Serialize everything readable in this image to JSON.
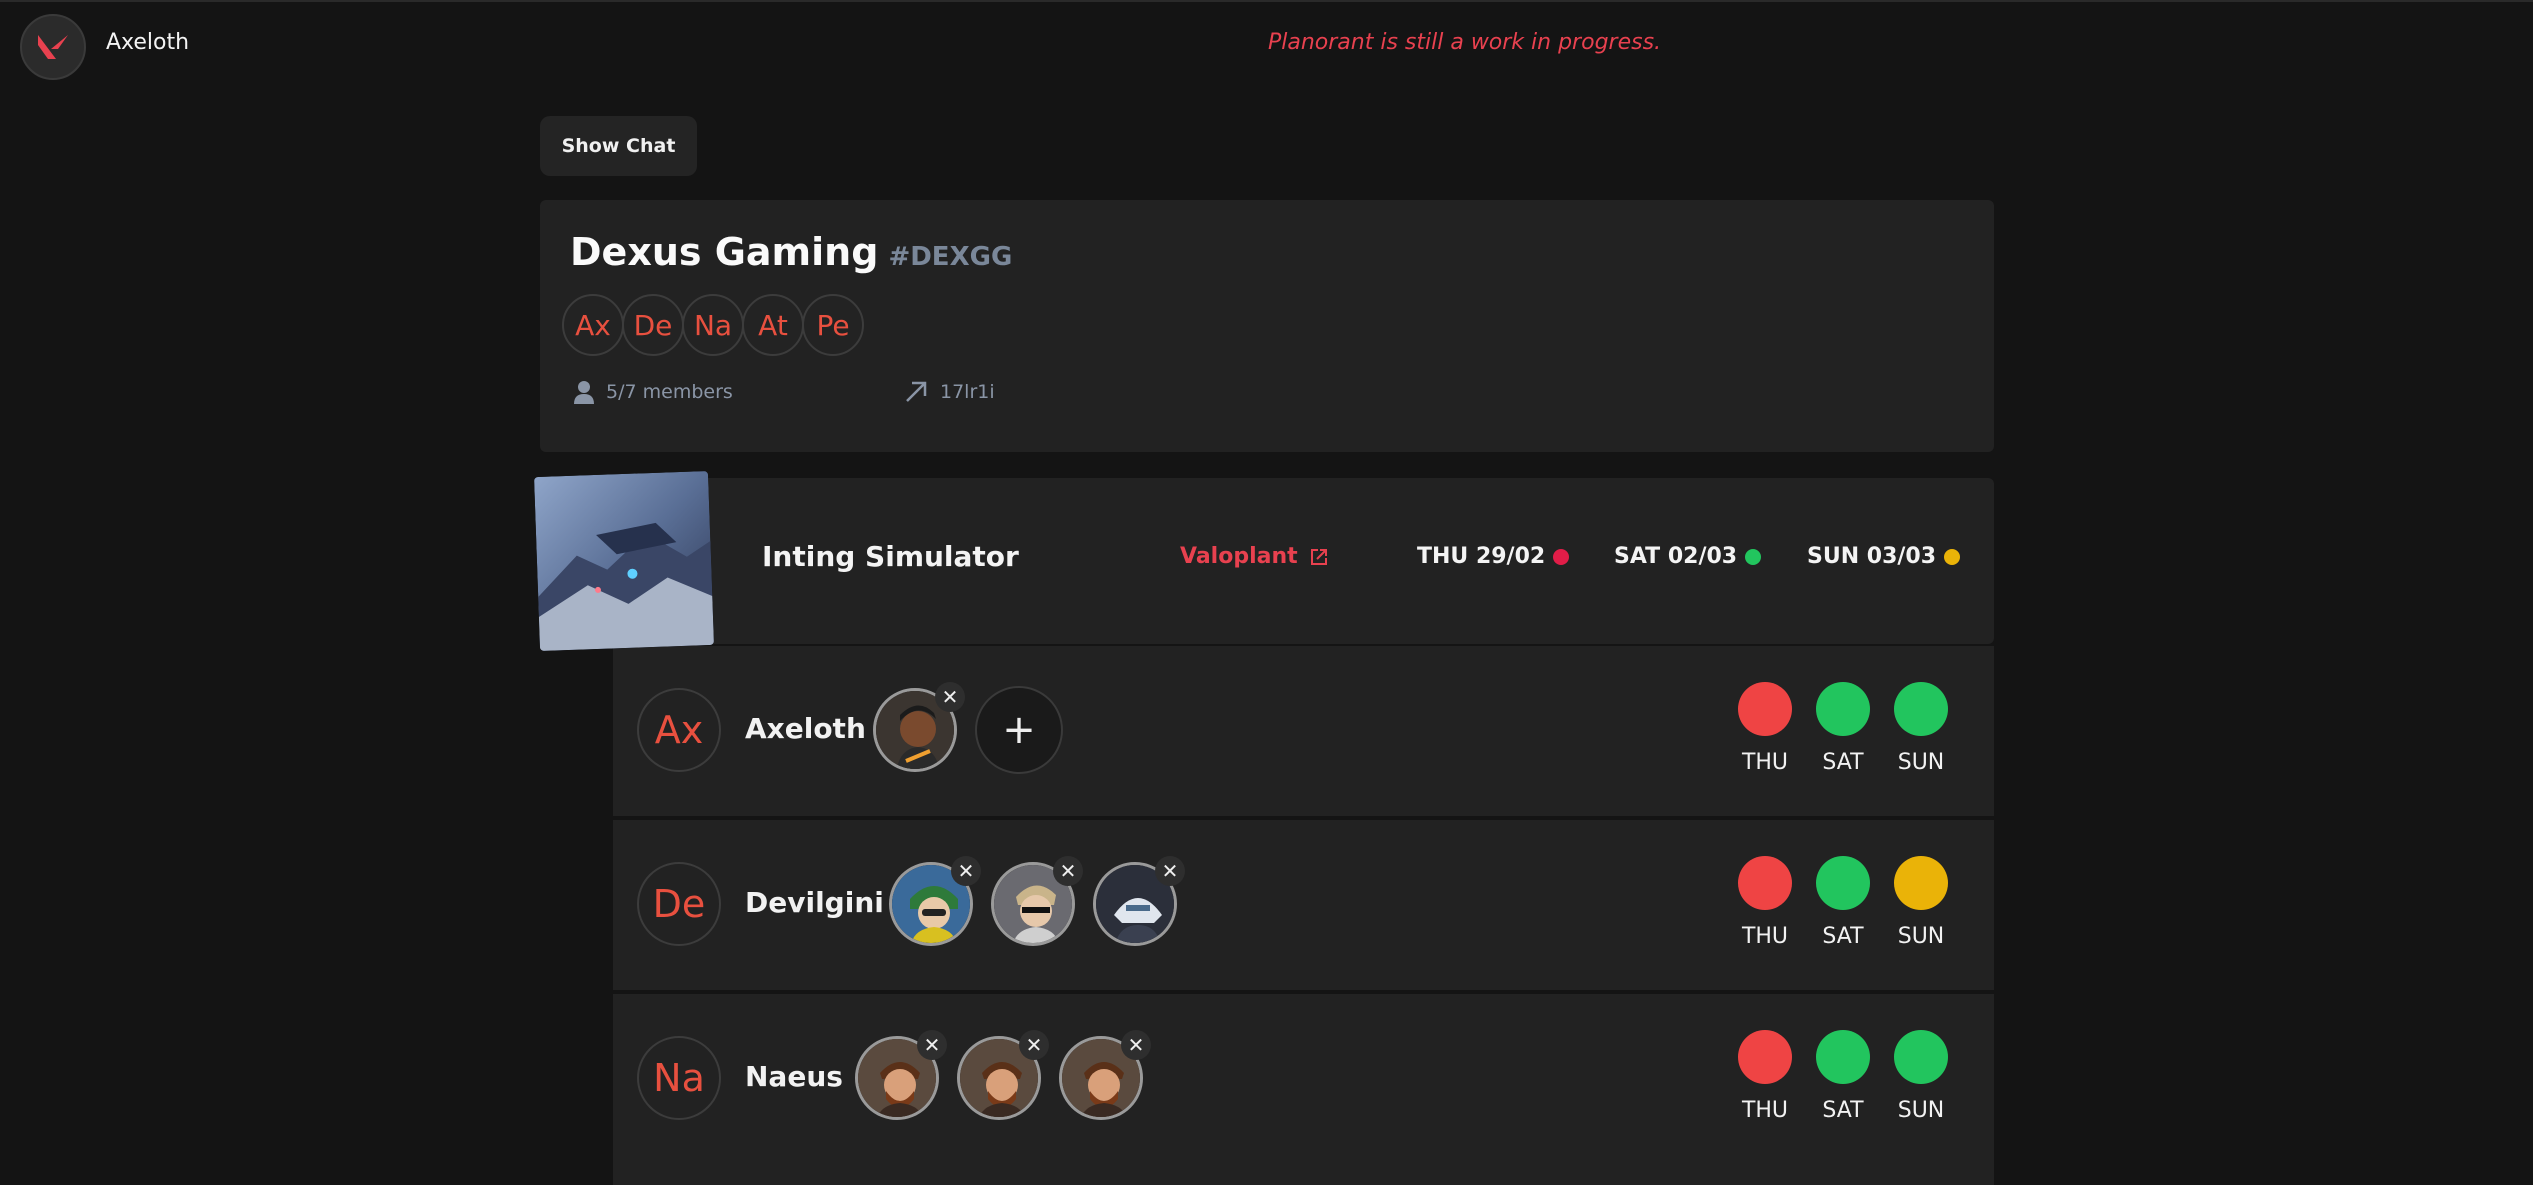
{
  "header": {
    "username": "Axeloth",
    "notice": "Planorant is still a work in progress."
  },
  "chat_button": "Show Chat",
  "team": {
    "name": "Dexus Gaming",
    "tag": "#DEXGG",
    "chips": [
      "Ax",
      "De",
      "Na",
      "At",
      "Pe"
    ],
    "members": "5/7 members",
    "code": "17lr1i"
  },
  "event": {
    "title": "Inting Simulator",
    "link": "Valoplant",
    "dates": [
      {
        "label": "THU 29/02",
        "color": "#e11d48"
      },
      {
        "label": "SAT 02/03",
        "color": "#22c55e"
      },
      {
        "label": "SUN 03/03",
        "color": "#eab308"
      }
    ]
  },
  "colors": {
    "red": "#ef4444",
    "green": "#22c55e",
    "yellow": "#eab308",
    "accent": "#e8414f"
  },
  "players": [
    {
      "initial": "Ax",
      "name": "Axeloth",
      "agents": [
        "agent-portrait-1"
      ],
      "availability": [
        {
          "day": "THU",
          "color": "#ef4444"
        },
        {
          "day": "SAT",
          "color": "#22c55e"
        },
        {
          "day": "SUN",
          "color": "#22c55e"
        }
      ]
    },
    {
      "initial": "De",
      "name": "Devilgini",
      "agents": [
        "agent-portrait-2",
        "agent-portrait-3",
        "agent-portrait-4"
      ],
      "availability": [
        {
          "day": "THU",
          "color": "#ef4444"
        },
        {
          "day": "SAT",
          "color": "#22c55e"
        },
        {
          "day": "SUN",
          "color": "#eab308"
        }
      ]
    },
    {
      "initial": "Na",
      "name": "Naeus",
      "agents": [
        "agent-portrait-5",
        "agent-portrait-5",
        "agent-portrait-5"
      ],
      "availability": [
        {
          "day": "THU",
          "color": "#ef4444"
        },
        {
          "day": "SAT",
          "color": "#22c55e"
        },
        {
          "day": "SUN",
          "color": "#22c55e"
        }
      ]
    }
  ]
}
